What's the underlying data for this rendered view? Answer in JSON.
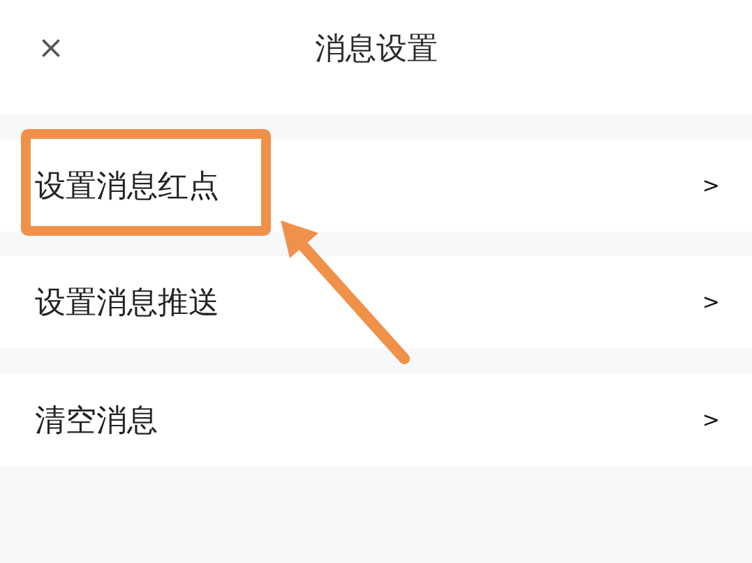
{
  "header": {
    "title": "消息设置"
  },
  "items": [
    {
      "label": "设置消息红点",
      "chevron": ">",
      "highlighted": true
    },
    {
      "label": "设置消息推送",
      "chevron": ">",
      "highlighted": false
    },
    {
      "label": "清空消息",
      "chevron": ">",
      "highlighted": false
    }
  ]
}
